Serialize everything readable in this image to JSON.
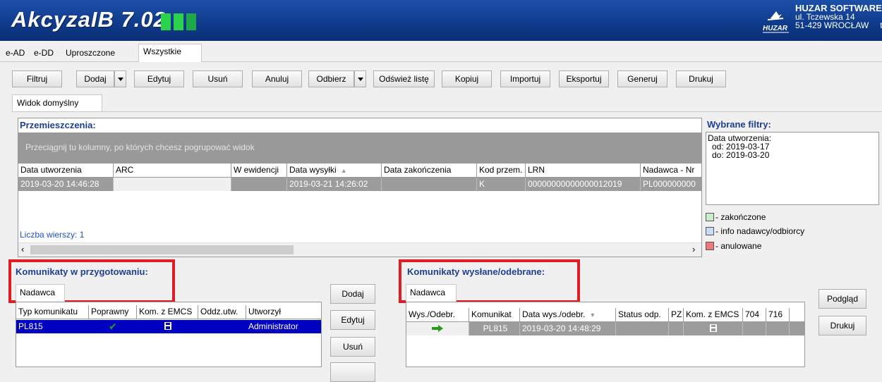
{
  "header": {
    "app_title": "AkcyzaIB 7.02",
    "company_name": "HUZAR SOFTWARE",
    "company_street": "ul. Tczewska 14",
    "company_city": "51-429 WROCŁAW",
    "company_cut": "te",
    "logo_text": "HUZAR"
  },
  "main_tabs": [
    "e-AD",
    "e-DD",
    "Uproszczone",
    "Wszystkie"
  ],
  "toolbar": {
    "filtruj": "Filtruj",
    "dodaj": "Dodaj",
    "edytuj": "Edytuj",
    "usun": "Usuń",
    "anuluj": "Anuluj",
    "odbierz": "Odbierz",
    "odswiez": "Odśwież listę",
    "kopiuj": "Kopiuj",
    "importuj": "Importuj",
    "eksportuj": "Eksportuj",
    "generuj": "Generuj",
    "drukuj": "Drukuj"
  },
  "view_tab": "Widok domyślny",
  "przemieszczenia": {
    "title": "Przemieszczenia:",
    "group_hint": "Przeciągnij tu kolumny, po których chcesz pogrupować widok",
    "columns": [
      "Data utworzenia",
      "ARC",
      "W ewidencji",
      "Data wysyłki",
      "Data zakończenia",
      "Kod przem.",
      "LRN",
      "Nadawca - Nr"
    ],
    "row": [
      "2019-03-20 14:46:28",
      "",
      "",
      "2019-03-21 14:26:02",
      "",
      "K",
      "00000000000000012019",
      "PL000000000"
    ],
    "row_count": "Liczba wierszy: 1"
  },
  "filters": {
    "title": "Wybrane filtry:",
    "line1": "Data utworzenia:",
    "line2": "od: 2019-03-17",
    "line3": "do: 2019-03-20",
    "legend": [
      {
        "label": "- zakończone",
        "color": "#c8f0c8"
      },
      {
        "label": "- info nadawcy/odbiorcy",
        "color": "#c8dcf5"
      },
      {
        "label": "- anulowane",
        "color": "#f07878"
      }
    ]
  },
  "prep": {
    "title": "Komunikaty w przygotowaniu:",
    "tab": "Nadawca",
    "columns": [
      "Typ komunikatu",
      "Poprawny",
      "Kom. z EMCS",
      "Oddz.utw.",
      "Utworzył"
    ],
    "row": [
      "PL815",
      "",
      "",
      "",
      "Administrator"
    ]
  },
  "middle_buttons": {
    "dodaj": "Dodaj",
    "edytuj": "Edytuj",
    "usun": "Usuń"
  },
  "sent": {
    "title": "Komunikaty wysłane/odebrane:",
    "tab": "Nadawca",
    "columns": [
      "Wys./Odebr.",
      "Komunikat",
      "Data wys./odebr.",
      "Status odp.",
      "PZ",
      "Kom. z EMCS",
      "704",
      "716"
    ],
    "row": [
      "",
      "PL815",
      "2019-03-20 14:48:29",
      "",
      "",
      "",
      "",
      ""
    ]
  },
  "right_buttons": {
    "podglad": "Podgląd",
    "drukuj": "Drukuj"
  },
  "colors": {
    "selection": "#0000c0",
    "grid_row_gray": "#9c9c9c",
    "title_blue": "#1c3f94",
    "highlight_red": "#e11c25"
  }
}
